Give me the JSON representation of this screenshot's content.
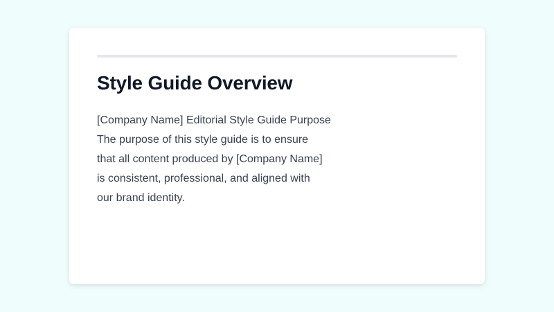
{
  "document": {
    "title": "Style Guide Overview",
    "body_lines": [
      "[Company Name] Editorial Style Guide Purpose",
      "The purpose of this style guide is to ensure",
      "that all content produced by [Company Name]",
      "is consistent, professional, and aligned with",
      "our brand identity."
    ]
  },
  "colors": {
    "page_background": "#effdfc",
    "card_background": "#ffffff",
    "title_text": "#111827",
    "body_text": "#374151",
    "divider": "#e5e7eb"
  }
}
